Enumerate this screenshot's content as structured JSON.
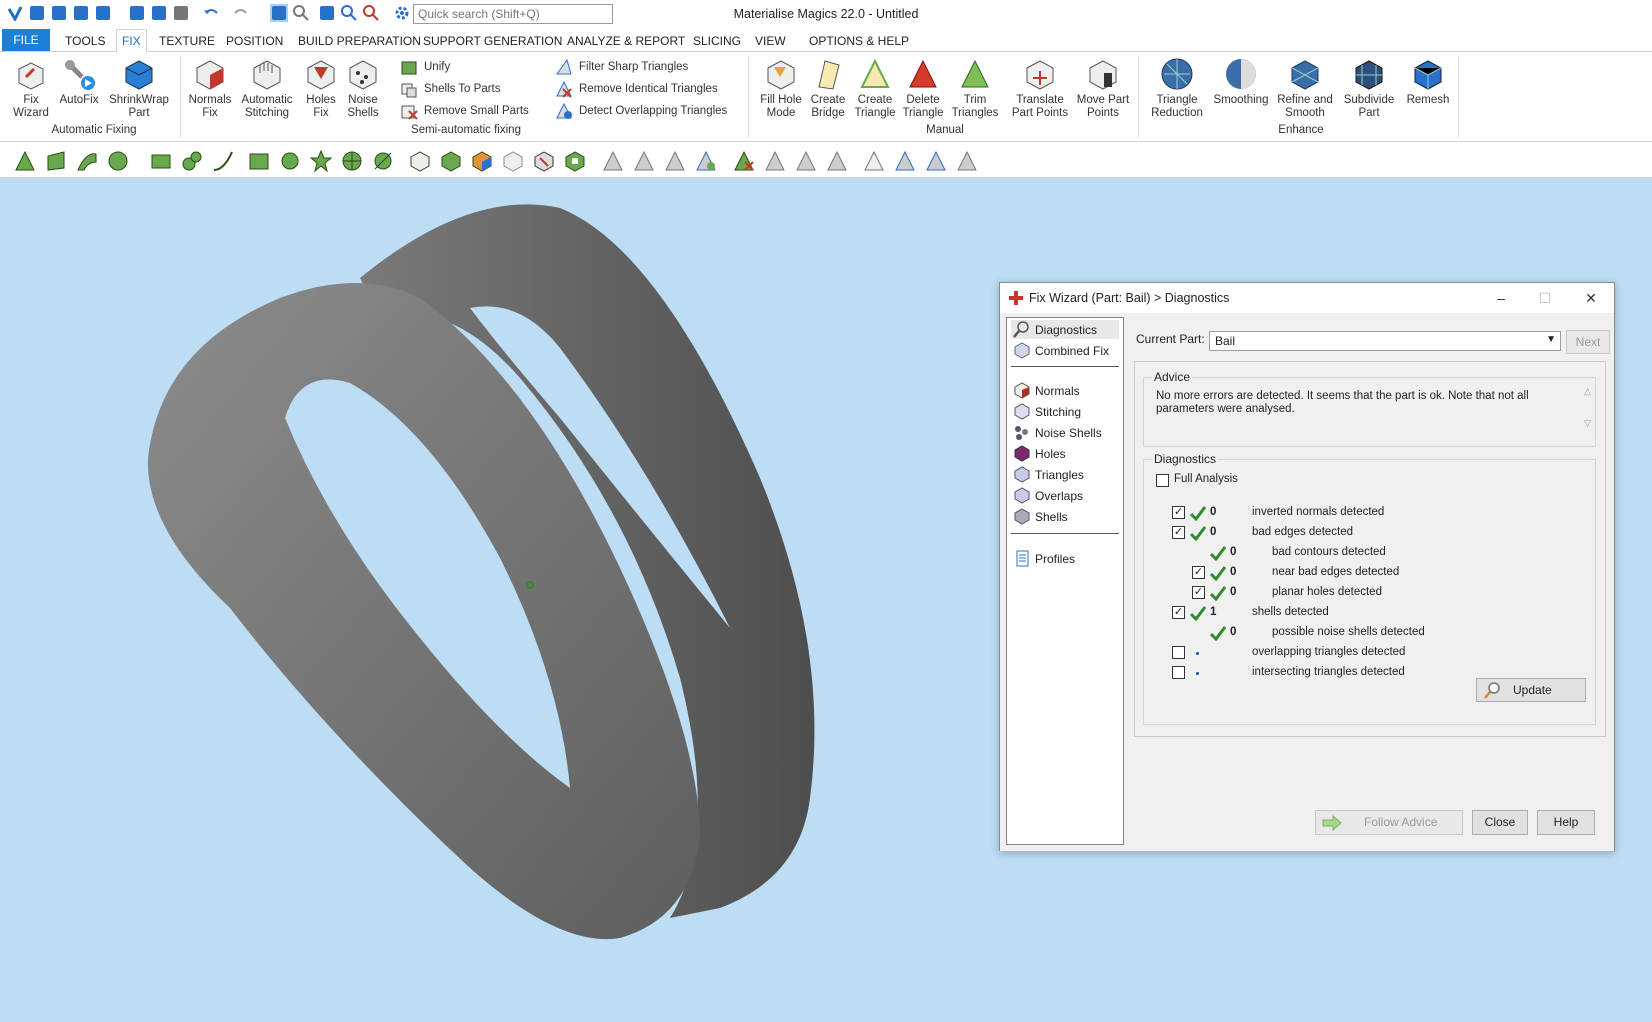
{
  "app": {
    "title": "Materialise Magics 22.0 - Untitled",
    "search_placeholder": "Quick search (Shift+Q)",
    "accent_color": "#1e7fd6"
  },
  "menu": {
    "tabs": [
      {
        "label": "FILE"
      },
      {
        "label": "TOOLS"
      },
      {
        "label": "FIX",
        "active": true
      },
      {
        "label": "TEXTURE"
      },
      {
        "label": "POSITION"
      },
      {
        "label": "BUILD PREPARATION"
      },
      {
        "label": "SUPPORT GENERATION"
      },
      {
        "label": "ANALYZE & REPORT"
      },
      {
        "label": "SLICING"
      },
      {
        "label": "VIEW"
      },
      {
        "label": "OPTIONS & HELP"
      }
    ]
  },
  "ribbon": {
    "groups": {
      "automatic": "Automatic Fixing",
      "semi": "Semi-automatic fixing",
      "manual": "Manual",
      "enhance": "Enhance"
    },
    "buttons": {
      "fix_wizard": "Fix\nWizard",
      "autofix": "AutoFix",
      "shrinkwrap": "ShrinkWrap\nPart",
      "normals_fix": "Normals\nFix",
      "auto_stitching": "Automatic\nStitching",
      "holes_fix": "Holes\nFix",
      "noise_shells": "Noise\nShells",
      "fill_hole": "Fill Hole\nMode",
      "create_bridge": "Create\nBridge",
      "create_triangle": "Create\nTriangle",
      "delete_triangle": "Delete\nTriangle",
      "trim_triangles": "Trim\nTriangles",
      "translate_points": "Translate\nPart Points",
      "move_points": "Move Part\nPoints",
      "triangle_reduction": "Triangle\nReduction",
      "smoothing": "Smoothing",
      "refine_smooth": "Refine and\nSmooth",
      "subdivide": "Subdivide\nPart",
      "remesh": "Remesh"
    },
    "small": {
      "unify": "Unify",
      "shells_to_parts": "Shells To Parts",
      "remove_small": "Remove Small Parts",
      "filter_sharp": "Filter Sharp Triangles",
      "remove_identical": "Remove Identical Triangles",
      "detect_overlapping": "Detect Overlapping Triangles"
    }
  },
  "dialog": {
    "title": "Fix Wizard (Part: Bail) > Diagnostics",
    "nav": {
      "diagnostics": "Diagnostics",
      "combined_fix": "Combined Fix",
      "normals": "Normals",
      "stitching": "Stitching",
      "noise_shells": "Noise Shells",
      "holes": "Holes",
      "triangles": "Triangles",
      "overlaps": "Overlaps",
      "shells": "Shells",
      "profiles": "Profiles"
    },
    "current_part_label": "Current Part:",
    "current_part_value": "Bail",
    "next": "Next",
    "advice_label": "Advice",
    "advice_text": "No more errors are detected. It seems that the part is ok. Note that not all parameters were analysed.",
    "diagnostics_label": "Diagnostics",
    "full_analysis": "Full Analysis",
    "full_analysis_checked": false,
    "items": [
      {
        "checked": true,
        "ok": true,
        "value": "0",
        "label": "inverted normals detected",
        "indent": 0,
        "has_box": true
      },
      {
        "checked": true,
        "ok": true,
        "value": "0",
        "label": "bad edges detected",
        "indent": 0,
        "has_box": true
      },
      {
        "checked": false,
        "ok": true,
        "value": "0",
        "label": "bad contours detected",
        "indent": 1,
        "has_box": false
      },
      {
        "checked": true,
        "ok": true,
        "value": "0",
        "label": "near bad edges detected",
        "indent": 1,
        "has_box": true
      },
      {
        "checked": true,
        "ok": true,
        "value": "0",
        "label": "planar holes detected",
        "indent": 1,
        "has_box": true
      },
      {
        "checked": true,
        "ok": true,
        "value": "1",
        "label": "shells detected",
        "indent": 0,
        "has_box": true
      },
      {
        "checked": false,
        "ok": true,
        "value": "0",
        "label": "possible noise shells detected",
        "indent": 1,
        "has_box": false
      },
      {
        "checked": false,
        "ok": false,
        "value": "",
        "label": "overlapping triangles detected",
        "indent": 0,
        "has_box": true
      },
      {
        "checked": false,
        "ok": false,
        "value": "",
        "label": "intersecting triangles detected",
        "indent": 0,
        "has_box": true
      }
    ],
    "update": "Update",
    "follow_advice": "Follow Advice",
    "close": "Close",
    "help": "Help"
  }
}
